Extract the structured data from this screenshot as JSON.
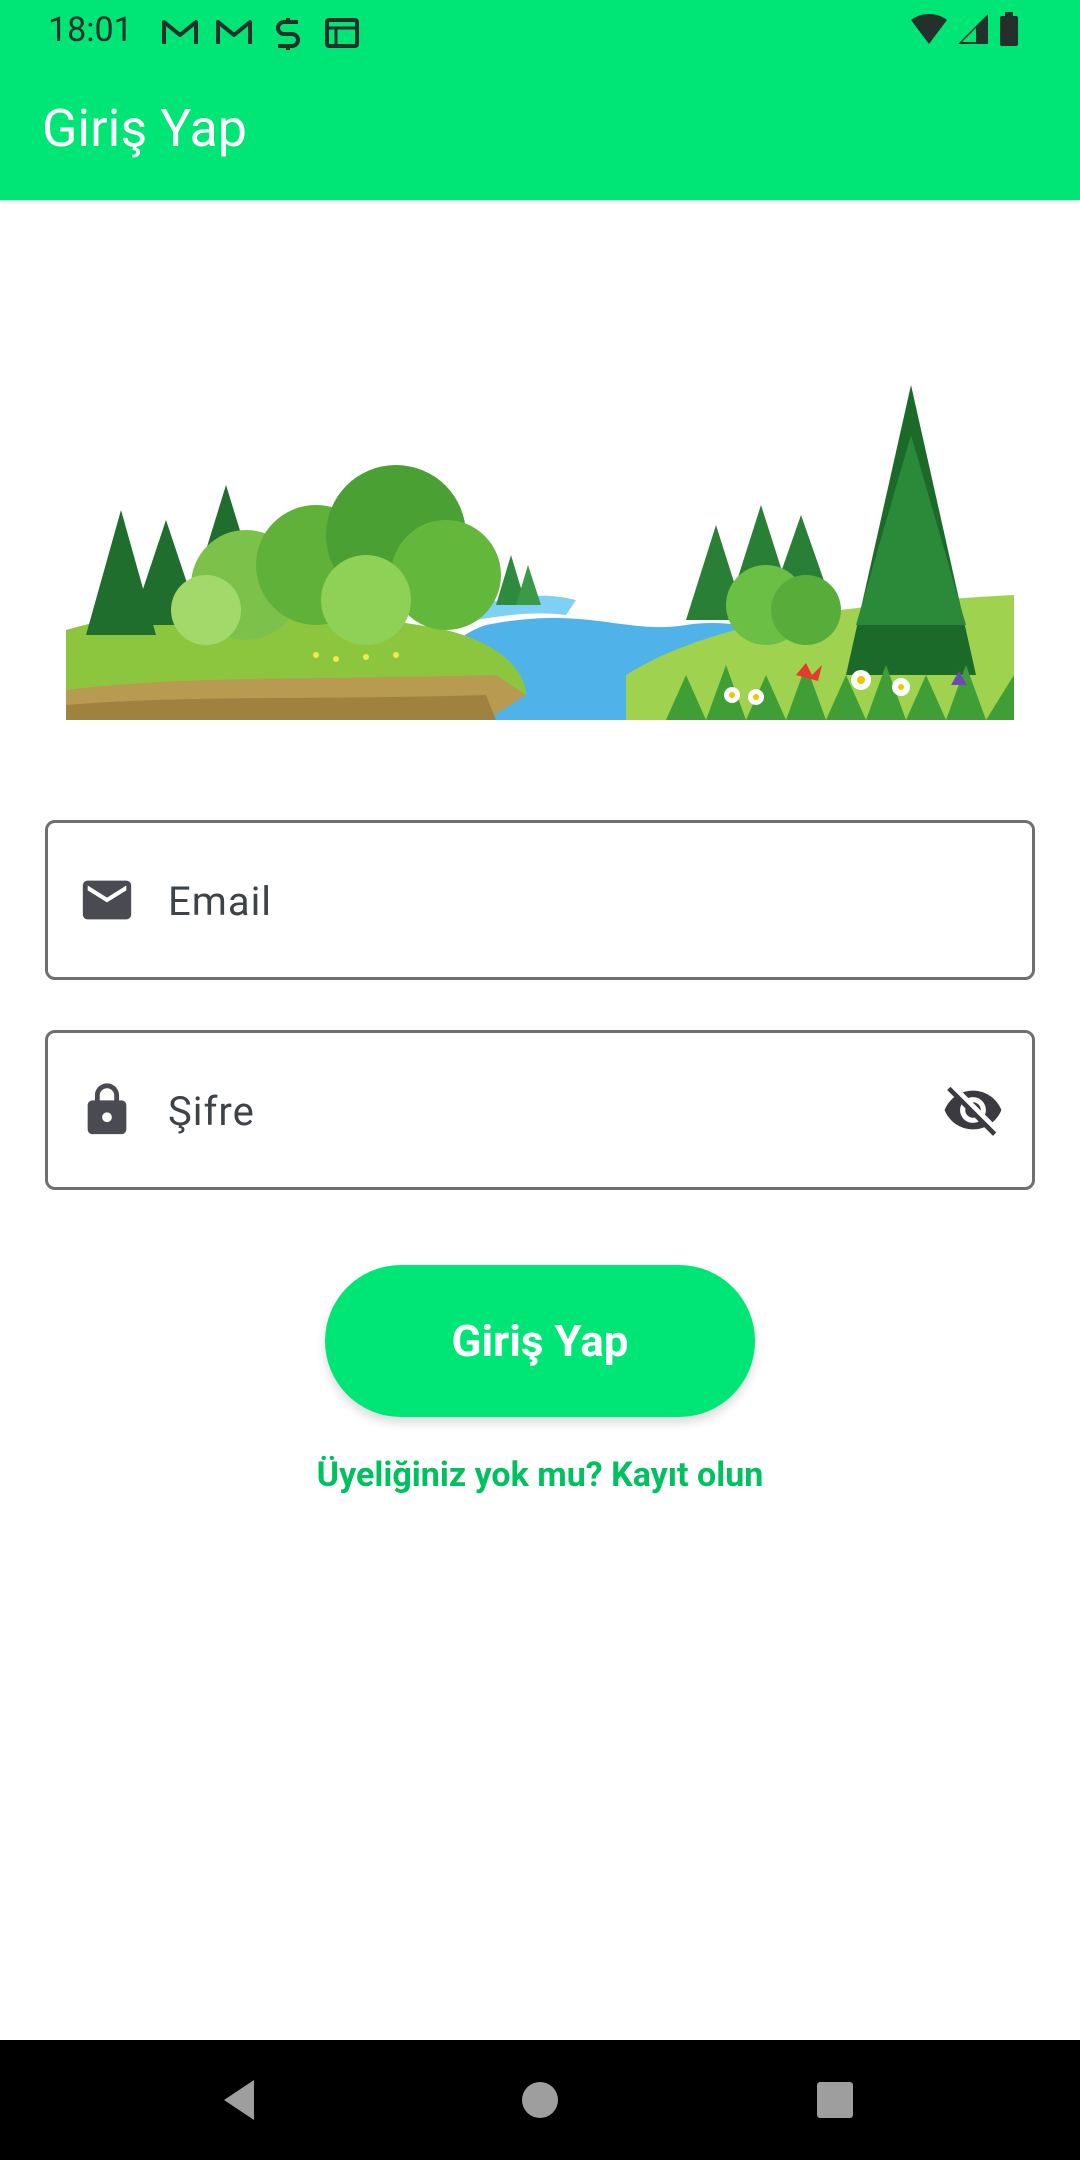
{
  "status_bar": {
    "time": "18:01",
    "left_icons": [
      "gmail-icon",
      "gmail-icon",
      "sync-icon",
      "calendar-icon"
    ],
    "right_icons": [
      "wifi-icon",
      "cell-signal-icon",
      "battery-icon"
    ]
  },
  "app_bar": {
    "title": "Giriş Yap"
  },
  "hero": {
    "image": "forest-river-landscape"
  },
  "form": {
    "email": {
      "placeholder": "Email",
      "value": "",
      "icon": "mail-icon"
    },
    "password": {
      "placeholder": "Şifre",
      "value": "",
      "icon": "lock-icon",
      "toggle_icon": "eye-off-icon"
    }
  },
  "login_button": {
    "label": "Giriş Yap"
  },
  "signup_link": {
    "label": "Üyeliğiniz yok mu? Kayıt olun"
  },
  "nav_bar": {
    "buttons": [
      "back-icon",
      "home-icon",
      "recents-icon"
    ]
  },
  "colors": {
    "primary": "#00e676",
    "link": "#00c160",
    "field_border": "#6f6f6f",
    "icon": "#4a4a52"
  }
}
